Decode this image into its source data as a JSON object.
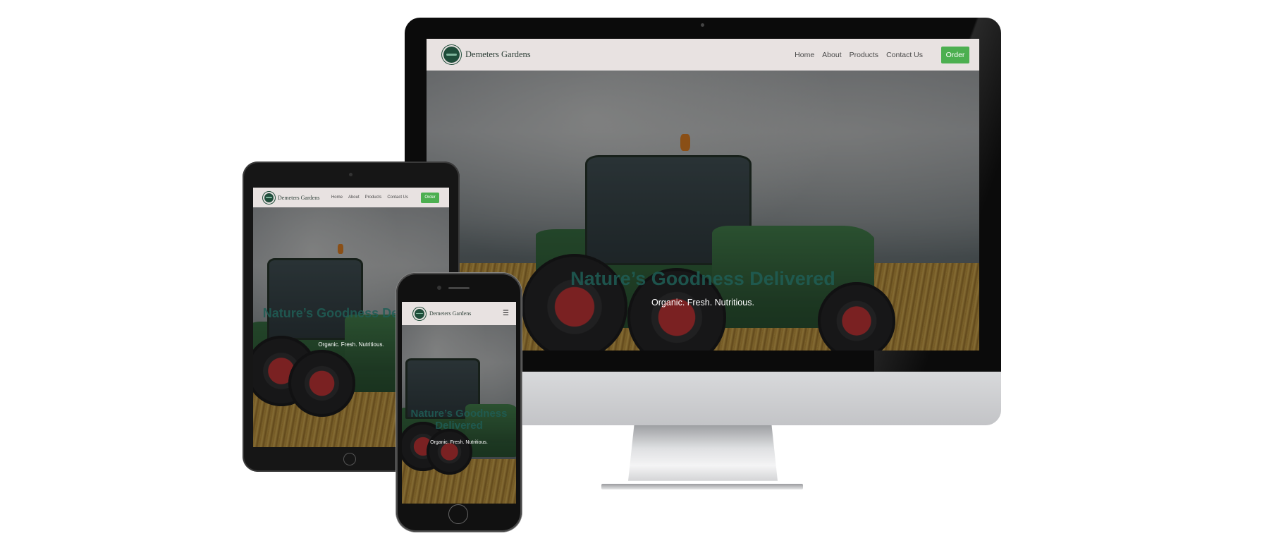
{
  "site": {
    "brand": "Demeters Gardens",
    "nav": {
      "home": "Home",
      "about": "About",
      "products": "Products",
      "contact": "Contact Us"
    },
    "order_label": "Order",
    "hero_title": "Nature’s Goodness Delivered",
    "hero_subtitle": "Organic. Fresh. Nutritious.",
    "menu_icon": "☰"
  },
  "colors": {
    "navbar_bg": "#e8e2e1",
    "order_button": "#4caf50",
    "hero_title": "#1f5e56",
    "logo": "#1f4d3a"
  },
  "icons": [
    "logo-icon",
    "apple-logo-icon",
    "hamburger-menu-icon"
  ]
}
